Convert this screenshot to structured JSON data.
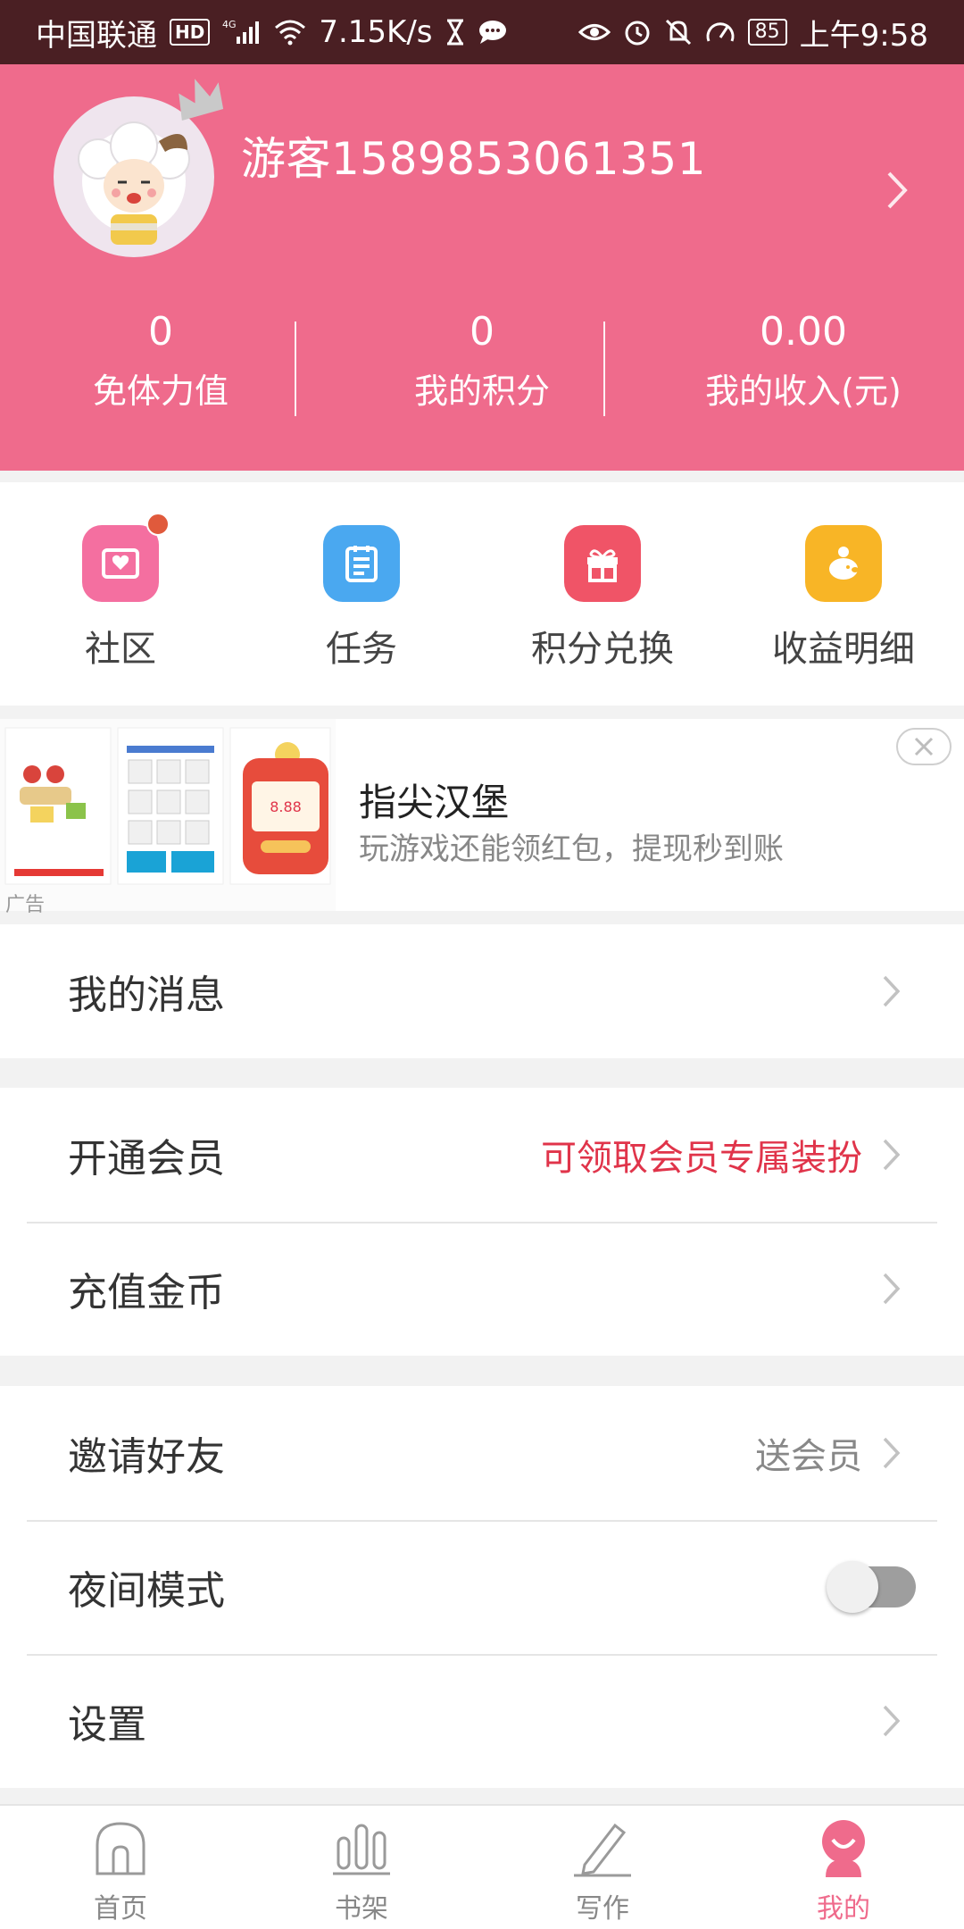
{
  "status_bar": {
    "carrier": "中国联通",
    "hd": "HD",
    "network": "4G",
    "speed": "7.15K/s",
    "battery": "85",
    "time": "上午9:58"
  },
  "profile": {
    "username": "游客1589853061351",
    "stats": [
      {
        "value": "0",
        "label": "免体力值"
      },
      {
        "value": "0",
        "label": "我的积分"
      },
      {
        "value": "0.00",
        "label": "我的收入(元)"
      }
    ]
  },
  "quick_actions": [
    {
      "label": "社区",
      "icon": "community-icon",
      "color": "#f46fa0",
      "badge": true
    },
    {
      "label": "任务",
      "icon": "task-icon",
      "color": "#4aa8f0",
      "badge": false
    },
    {
      "label": "积分兑换",
      "icon": "gift-icon",
      "color": "#f05467",
      "badge": false
    },
    {
      "label": "收益明细",
      "icon": "piggy-bank-icon",
      "color": "#f8b526",
      "badge": false
    }
  ],
  "ad": {
    "title": "指尖汉堡",
    "description": "玩游戏还能领红包，提现秒到账",
    "tag": "广告",
    "red_packet_amount": "8.88"
  },
  "menu": {
    "messages": {
      "label": "我的消息"
    },
    "vip": {
      "label": "开通会员",
      "extra": "可领取会员专属装扮"
    },
    "recharge": {
      "label": "充值金币"
    },
    "invite": {
      "label": "邀请好友",
      "extra": "送会员"
    },
    "night_mode": {
      "label": "夜间模式",
      "enabled": false
    },
    "settings": {
      "label": "设置"
    }
  },
  "bottom_nav": [
    {
      "label": "首页",
      "icon": "home-icon",
      "active": false
    },
    {
      "label": "书架",
      "icon": "bookshelf-icon",
      "active": false
    },
    {
      "label": "写作",
      "icon": "pen-icon",
      "active": false
    },
    {
      "label": "我的",
      "icon": "profile-icon",
      "active": true
    }
  ],
  "colors": {
    "brand": "#ef6b8c",
    "status_bar": "#4a1f23",
    "accent_red": "#e0344a"
  }
}
